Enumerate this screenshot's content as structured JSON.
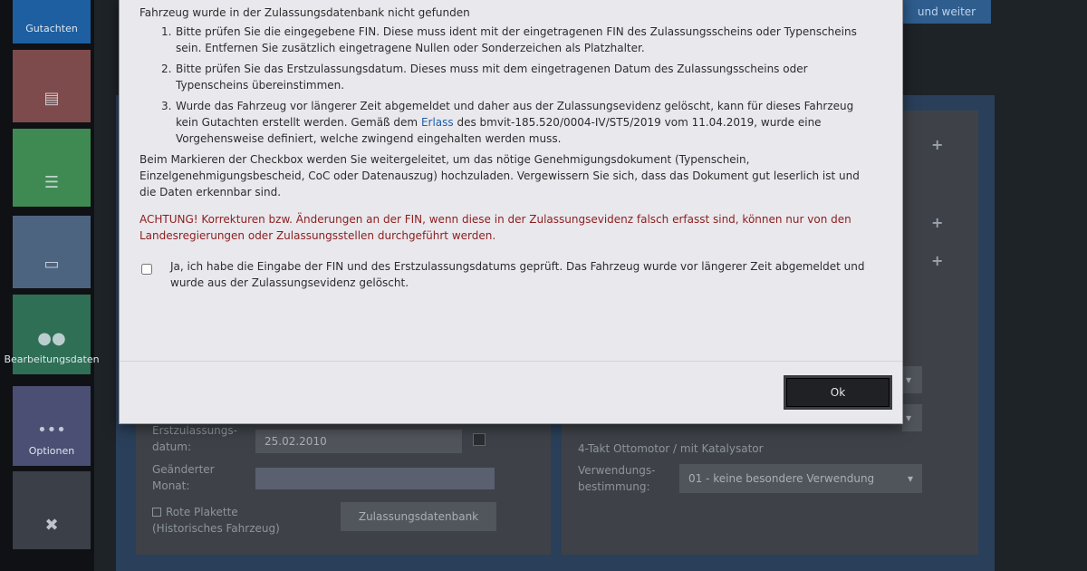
{
  "sidebar": {
    "items": [
      {
        "label": "Gutachten",
        "icon": "document-icon"
      },
      {
        "label": "",
        "icon": "car-icon"
      },
      {
        "label": "",
        "icon": "list-icon"
      },
      {
        "label": "",
        "icon": "tablet-icon"
      },
      {
        "label": "Bearbeitungsdaten",
        "icon": "people-icon"
      },
      {
        "label": "Optionen",
        "icon": "dots-icon"
      },
      {
        "label": "",
        "icon": "tools-icon"
      }
    ]
  },
  "header": {
    "next_button": "und weiter"
  },
  "form": {
    "erstzulassung_label": "Erstzulassungs-\ndatum:",
    "erstzulassung_value": "25.02.2010",
    "geaenderter_monat_label": "Geänderter\nMonat:",
    "rote_plakette_label": "Rote Plakette",
    "historisch_label": "(Historisches Fahrzeug)",
    "zulassungsdatenbank_button": "Zulassungsdatenbank",
    "motor_text": "4-Takt Ottomotor / mit Katalysator",
    "verwendung_label": "Verwendungs-\nbestimmung:",
    "verwendung_value": "01 - keine besondere Verwendung"
  },
  "modal": {
    "title": "Fahrzeug wurde in der Zulassungsdatenbank nicht gefunden",
    "items": [
      {
        "num": "1.",
        "text": "Bitte prüfen Sie die eingegebene FIN. Diese muss ident mit der eingetragenen FIN des Zulassungsscheins oder Typenscheins sein. Entfernen Sie zusätzlich eingetragene Nullen oder Sonderzeichen als Platzhalter."
      },
      {
        "num": "2.",
        "text": "Bitte prüfen Sie das Erstzulassungsdatum. Dieses muss mit dem eingetragenen Datum des Zulassungsscheins oder Typenscheins übereinstimmen."
      },
      {
        "num": "3.",
        "text_before": "Wurde das Fahrzeug vor längerer Zeit abgemeldet und daher aus der Zulassungsevidenz gelöscht, kann für dieses Fahrzeug kein Gutachten erstellt werden. Gemäß dem ",
        "link": "Erlass",
        "text_after": " des bmvit-185.520/0004-IV/ST5/2019 vom 11.04.2019, wurde eine Vorgehensweise definiert, welche zwingend eingehalten werden muss."
      }
    ],
    "info": "Beim Markieren der Checkbox werden Sie weitergeleitet, um das nötige Genehmigungsdokument (Typenschein, Einzelgenehmigungsbescheid, CoC oder Datenauszug) hochzuladen. Vergewissern Sie sich, dass das Dokument gut leserlich ist und die Daten erkennbar sind.",
    "warning": "ACHTUNG! Korrekturen bzw. Änderungen an der FIN, wenn diese in der Zulassungsevidenz falsch erfasst sind, können nur von den Landesregierungen oder Zulassungsstellen durchgeführt werden.",
    "checkbox_label": "Ja, ich habe die Eingabe der FIN und des Erstzulassungsdatums geprüft. Das Fahrzeug wurde vor längerer Zeit abgemeldet und wurde aus der Zulassungsevidenz gelöscht.",
    "ok_button": "Ok"
  }
}
